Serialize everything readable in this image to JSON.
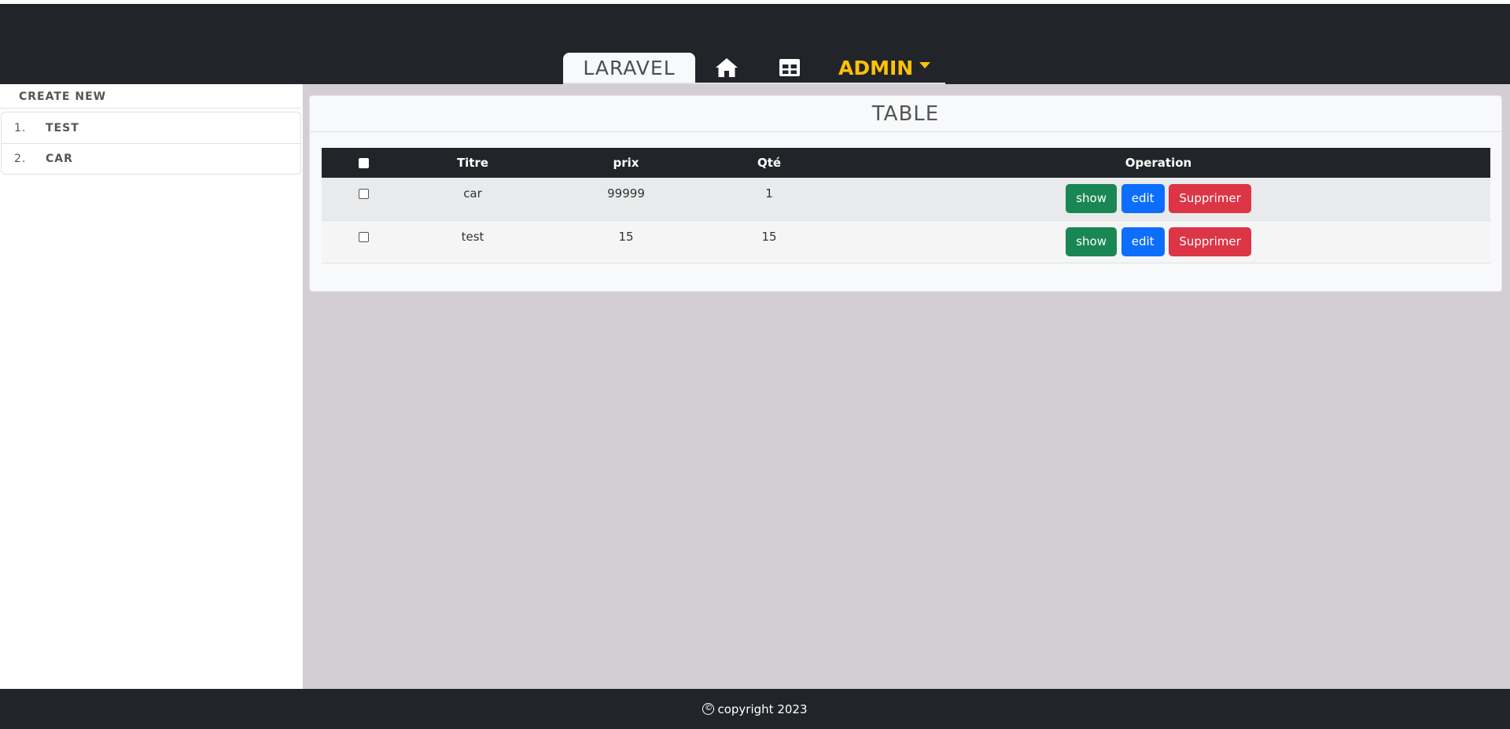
{
  "nav": {
    "brand": "LARAVEL",
    "home_icon": "home-icon",
    "table_icon": "table-icon",
    "admin_label": "ADMIN",
    "admin_color": "#ffc107"
  },
  "sidebar": {
    "create_label": "CREATE NEW",
    "items": [
      {
        "num": "1.",
        "label": "TEST"
      },
      {
        "num": "2.",
        "label": "CAR"
      }
    ]
  },
  "card": {
    "title": "TABLE",
    "columns": [
      "Titre",
      "prix",
      "Qté",
      "Operation"
    ],
    "rows": [
      {
        "titre": "car",
        "prix": "99999",
        "qte": "1"
      },
      {
        "titre": "test",
        "prix": "15",
        "qte": "15"
      }
    ],
    "buttons": {
      "show": "show",
      "edit": "edit",
      "delete": "Supprimer"
    }
  },
  "footer": {
    "copyright_symbol": "©",
    "text": "copyright 2023"
  }
}
